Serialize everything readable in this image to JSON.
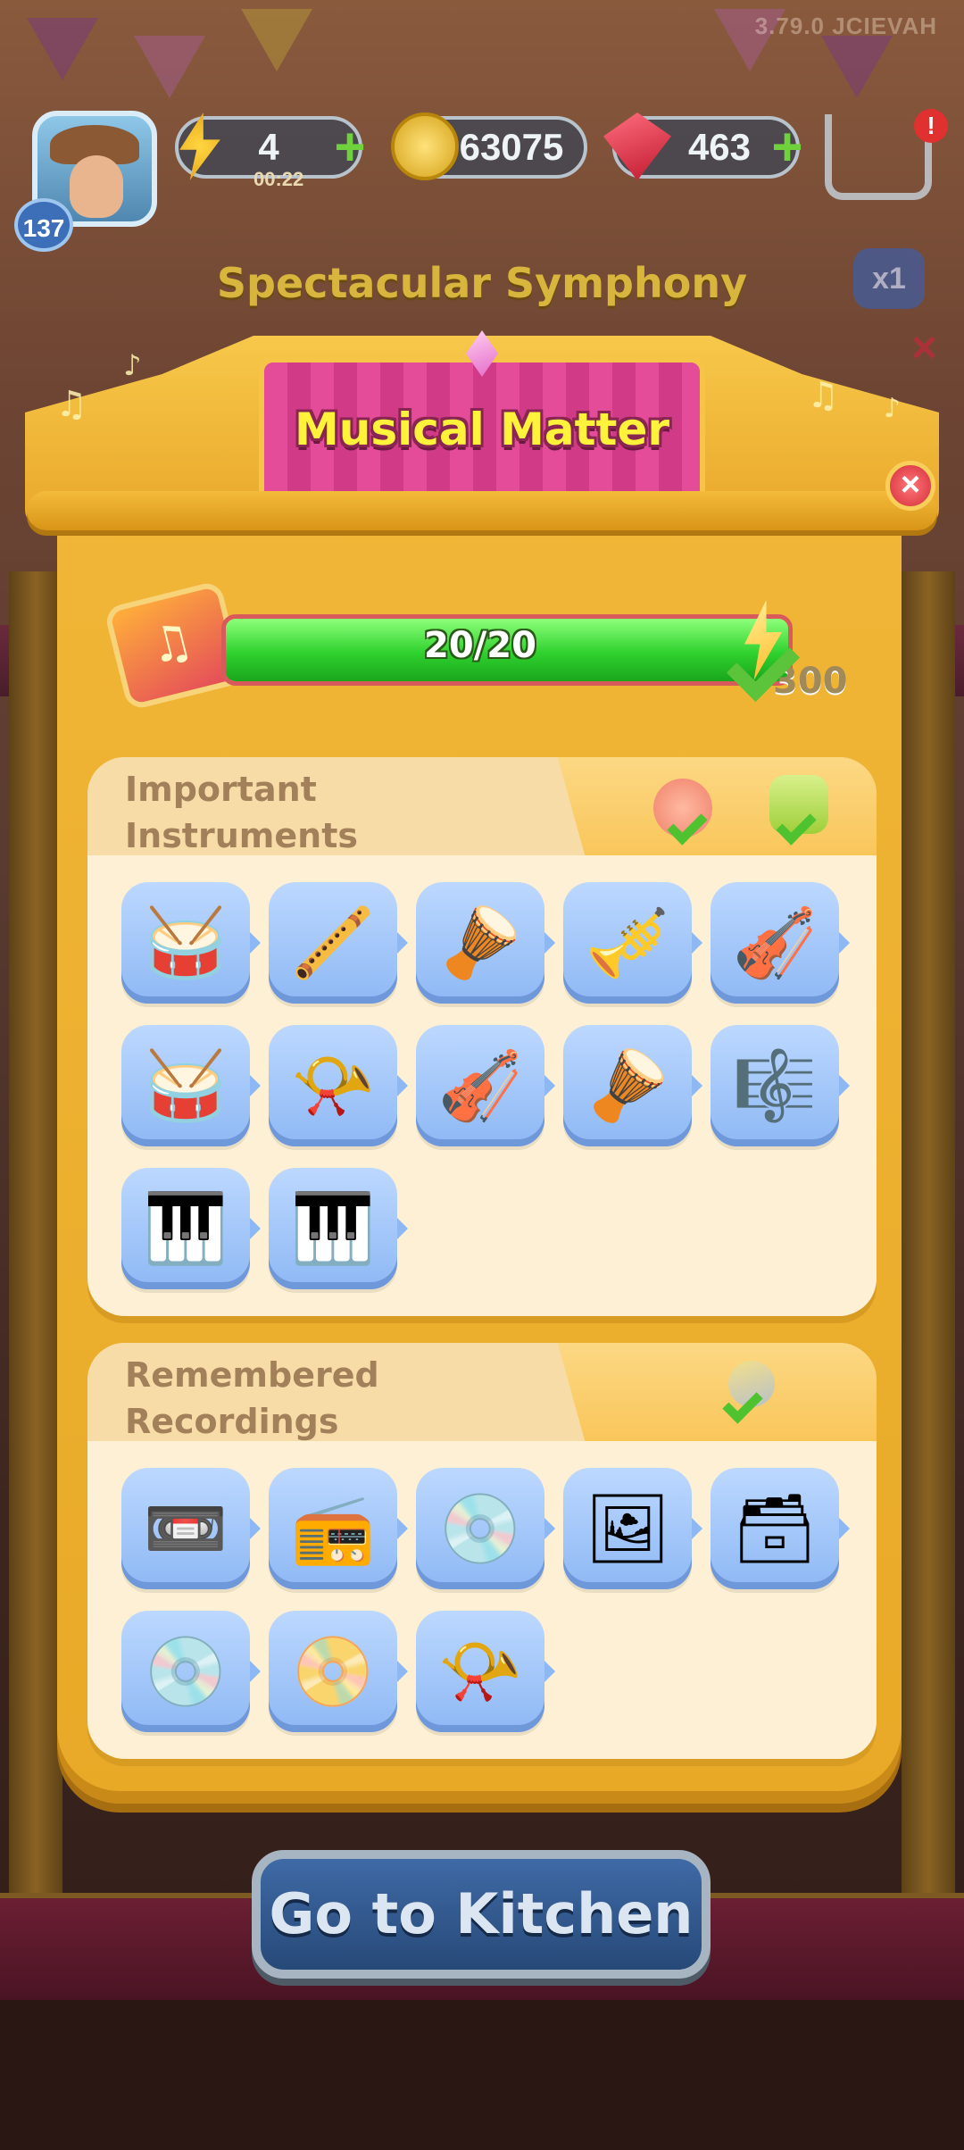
{
  "version_label": "3.79.0 JCIEVAH",
  "hud": {
    "level": "137",
    "energy": "4",
    "energy_timer": "00:22",
    "coins": "63075",
    "gems": "463",
    "plus": "+",
    "cart_alert": "!"
  },
  "background": {
    "title": "Spectacular Symphony",
    "multiplier": "x1",
    "close": "×"
  },
  "modal": {
    "title": "Musical Matter",
    "close": "×",
    "progress_text": "20/20",
    "progress_fraction": 1.0,
    "reward_count": "300"
  },
  "sections": [
    {
      "title_line1": "Important",
      "title_line2": "Instruments",
      "items": [
        {
          "icon": "cymbals-icon",
          "glyph": "🥁"
        },
        {
          "icon": "flute-icon",
          "glyph": "🪈"
        },
        {
          "icon": "tambourine-icon",
          "glyph": "🪘"
        },
        {
          "icon": "trumpet-icon",
          "glyph": "🎺"
        },
        {
          "icon": "violin-icon",
          "glyph": "🎻"
        },
        {
          "icon": "drum-icon",
          "glyph": "🥁"
        },
        {
          "icon": "french-horn-icon",
          "glyph": "📯"
        },
        {
          "icon": "cello-icon",
          "glyph": "🎻"
        },
        {
          "icon": "bass-drum-icon",
          "glyph": "🪘"
        },
        {
          "icon": "harp-icon",
          "glyph": "🎼"
        },
        {
          "icon": "xylophone-icon",
          "glyph": "🎹"
        },
        {
          "icon": "grand-piano-icon",
          "glyph": "🎹"
        }
      ]
    },
    {
      "title_line1": "Remembered",
      "title_line2": "Recordings",
      "items": [
        {
          "icon": "cassette-tape-icon",
          "glyph": "📼"
        },
        {
          "icon": "cassette-player-icon",
          "glyph": "📻"
        },
        {
          "icon": "cd-case-icon",
          "glyph": "💿"
        },
        {
          "icon": "photo-stack-icon",
          "glyph": "🖼"
        },
        {
          "icon": "record-crate-icon",
          "glyph": "🗃"
        },
        {
          "icon": "vinyl-record-icon",
          "glyph": "💿"
        },
        {
          "icon": "record-player-icon",
          "glyph": "📀"
        },
        {
          "icon": "gramophone-icon",
          "glyph": "📯"
        }
      ]
    }
  ],
  "button": {
    "label": "Go to Kitchen"
  },
  "colors": {
    "progress_green": "#2fd12e",
    "panel_gold": "#f1b637",
    "title_pink": "#e44c9a",
    "tile_blue": "#a6c8fa",
    "button_blue": "#2f5688"
  }
}
